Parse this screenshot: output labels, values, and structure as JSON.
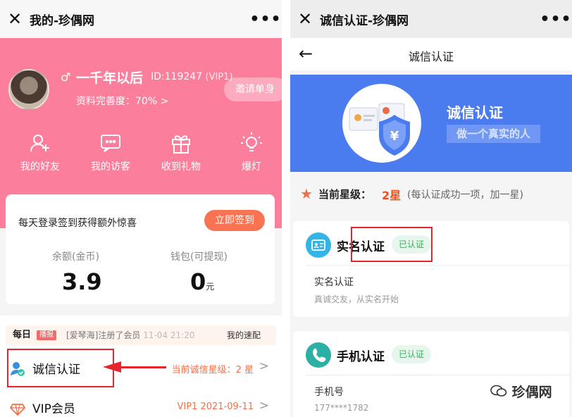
{
  "left": {
    "title": "我的-珍偶网",
    "more": "•••",
    "close": "✕",
    "profile": {
      "gender_symbol": "♂",
      "name": "一千年以后",
      "id": "ID:119247",
      "vip": "(VIP1)",
      "invite": "邀请单身",
      "completion": "资料完善度：70% >"
    },
    "quick_menu": [
      {
        "label": "我的好友",
        "icon": "add-friend-icon"
      },
      {
        "label": "我的访客",
        "icon": "message-icon"
      },
      {
        "label": "收到礼物",
        "icon": "gift-icon"
      },
      {
        "label": "爆灯",
        "icon": "lightbulb-icon"
      }
    ],
    "sign": {
      "text": "每天登录签到获得额外惊喜",
      "button": "立即签到",
      "balance_label": "余额(金币)",
      "balance_value": "3.9",
      "wallet_label": "钱包(可提现)",
      "wallet_value": "0",
      "wallet_unit": "元"
    },
    "daily": {
      "tag": "每日",
      "badge": "播报",
      "message": "[爱琴海]注册了会员",
      "time": "11-04 21:20",
      "speed": "我的速配"
    },
    "menu": [
      {
        "label": "诚信认证",
        "value": "当前诚信星级：2 星",
        "chevron": ">"
      },
      {
        "label": "VIP会员",
        "value": "VIP1 2021-09-11",
        "chevron": ">"
      }
    ]
  },
  "right": {
    "title": "诚信认证-珍偶网",
    "more": "•••",
    "close": "✕",
    "nav_title": "诚信认证",
    "back": "←",
    "banner": {
      "title": "诚信认证",
      "subtitle": "做一个真实的人"
    },
    "star": {
      "label": "当前星级：",
      "value": "2星",
      "note": "(每认证成功一项，加一星)"
    },
    "cards": [
      {
        "title": "实名认证",
        "badge": "已认证",
        "line1": "实名认证",
        "line2": "真诚交友，从实名开始",
        "icon": "id-card-icon"
      },
      {
        "title": "手机认证",
        "badge": "已认证",
        "line1": "手机号",
        "line2": "177****1782",
        "icon": "phone-icon"
      }
    ]
  },
  "watermark": "珍偶网",
  "colors": {
    "pink": "#fb7f9d",
    "orange": "#f87352",
    "blue_banner": "#4a7cf0",
    "green_badge": "#2fb35a",
    "annotation_red": "#e5242b"
  }
}
